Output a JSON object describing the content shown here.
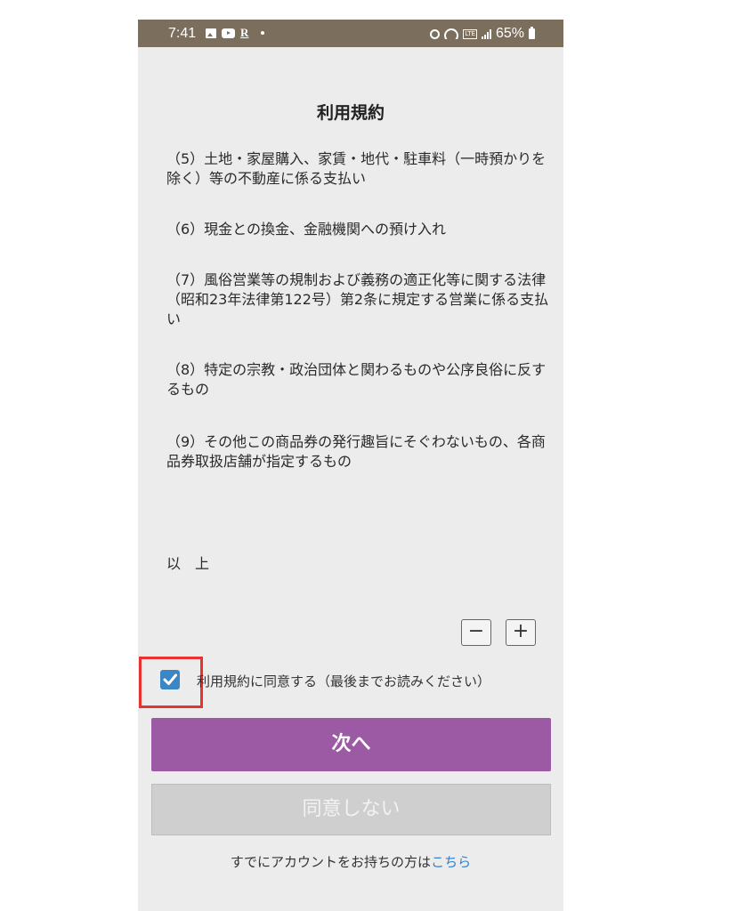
{
  "status_bar": {
    "time": "7:41",
    "carrier_mark": "R",
    "battery": "65%",
    "icons": [
      "gallery-icon",
      "youtube-icon",
      "r-icon",
      "dot-icon",
      "alarm-icon",
      "wifi-icon",
      "volte-icon",
      "signal-icon",
      "battery-icon"
    ]
  },
  "page": {
    "title": "利用規約"
  },
  "terms": {
    "items": [
      "（5）土地・家屋購入、家賃・地代・駐車料（一時預かりを除く）等の不動産に係る支払い",
      "（6）現金との換金、金融機関への預け入れ",
      "（7）風俗営業等の規制および義務の適正化等に関する法律（昭和23年法律第122号）第2条に規定する営業に係る支払い",
      "（8）特定の宗教・政治団体と関わるものや公序良俗に反するもの",
      "（9）その他この商品券の発行趣旨にそぐわないもの、各商品券取扱店舗が指定するもの"
    ],
    "closing": "以　上"
  },
  "zoom": {
    "minus_label": "−",
    "plus_label": "+"
  },
  "agreement": {
    "checked": true,
    "label": "利用規約に同意する（最後までお読みください）"
  },
  "buttons": {
    "next": "次へ",
    "disagree": "同意しない"
  },
  "account": {
    "prefix": "すでにアカウントをお持ちの方は",
    "link": "こちら"
  },
  "colors": {
    "status_bar": "#7c6e5d",
    "background": "#ececec",
    "primary_button": "#9d5aa4",
    "disabled_button": "#cfcfcf",
    "checkbox": "#3d86c6",
    "highlight": "#e8322f",
    "link": "#2f7fd0"
  }
}
